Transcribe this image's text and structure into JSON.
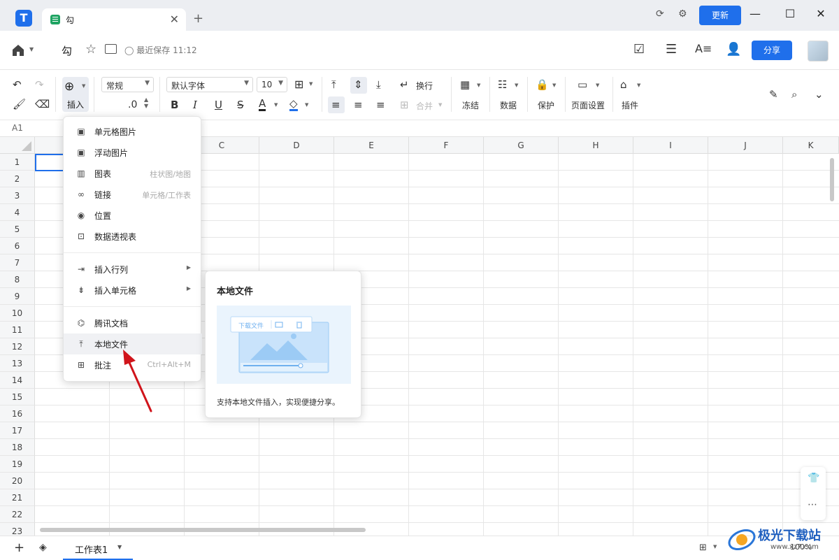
{
  "titlebar": {
    "tab_title": "勾",
    "tab_close": "✕",
    "new_tab": "+",
    "update_label": "更新",
    "window": {
      "minimize": "—",
      "maximize": "☐",
      "close": "✕"
    }
  },
  "docbar": {
    "title": "勾",
    "save_status": "最近保存 11:12",
    "share_label": "分享"
  },
  "toolbar": {
    "insert_label": "插入",
    "number_format": "常规",
    "decimal_label": ".0",
    "font_family": "默认字体",
    "font_size": "10",
    "wrap_label": "换行",
    "merge_label": "合并",
    "freeze_label": "冻结",
    "data_label": "数据",
    "protect_label": "保护",
    "page_setup_label": "页面设置",
    "plugin_label": "插件"
  },
  "formula": {
    "cell_ref": "A1"
  },
  "grid": {
    "columns": [
      "C",
      "D",
      "E",
      "F",
      "G",
      "H",
      "I",
      "J",
      "K"
    ],
    "rows": [
      "1",
      "2",
      "3",
      "4",
      "5",
      "6",
      "7",
      "8",
      "9",
      "10",
      "11",
      "12",
      "13",
      "14",
      "15",
      "16",
      "17",
      "18",
      "19",
      "20",
      "21",
      "22",
      "23"
    ]
  },
  "insert_menu": {
    "items": [
      {
        "label": "单元格图片",
        "hint": "",
        "icon": "image-icon"
      },
      {
        "label": "浮动图片",
        "hint": "",
        "icon": "image-icon"
      },
      {
        "label": "图表",
        "hint": "柱状图/地图",
        "icon": "chart-icon"
      },
      {
        "label": "链接",
        "hint": "单元格/工作表",
        "icon": "link-icon"
      },
      {
        "label": "位置",
        "hint": "",
        "icon": "location-icon"
      },
      {
        "label": "数据透视表",
        "hint": "",
        "icon": "pivot-table-icon"
      },
      {
        "label": "插入行列",
        "hint": "",
        "icon": "insert-row-col-icon"
      },
      {
        "label": "插入单元格",
        "hint": "",
        "icon": "insert-cell-icon"
      },
      {
        "label": "腾讯文档",
        "hint": "",
        "icon": "tencent-docs-icon"
      },
      {
        "label": "本地文件",
        "hint": "",
        "icon": "upload-icon"
      },
      {
        "label": "批注",
        "hint": "Ctrl+Alt+M",
        "icon": "comment-icon"
      }
    ],
    "submenu_arrow": "▶"
  },
  "preview": {
    "title": "本地文件",
    "download_label": "下载文件",
    "description": "支持本地文件插入，实现便捷分享。"
  },
  "bottombar": {
    "add_sheet": "+",
    "sheet_tab": "工作表1",
    "sheet_caret": "▼",
    "zoom": "100%"
  },
  "watermark": {
    "title": "极光下载站",
    "url": "www.xz7.com"
  },
  "colors": {
    "accent": "#1f6feb",
    "sheet_green": "#1fa463",
    "arrow_red": "#d0141b"
  }
}
